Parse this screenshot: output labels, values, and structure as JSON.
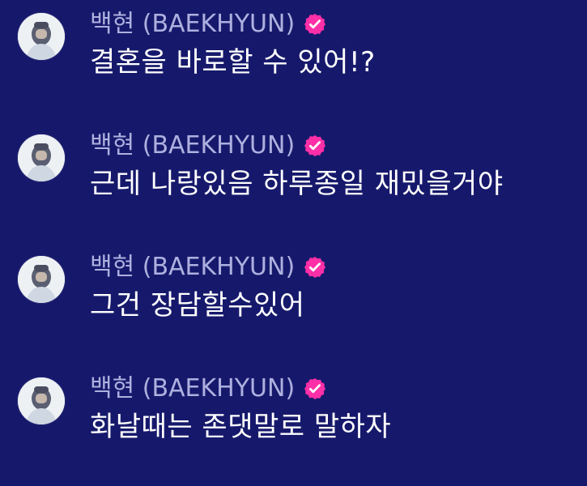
{
  "messages": [
    {
      "sender_name": "백현 (BAEKHYUN)",
      "text": "결혼을 바로할 수 있어!?"
    },
    {
      "sender_name": "백현 (BAEKHYUN)",
      "text": "근데 나랑있음 하루종일 재밌을거야"
    },
    {
      "sender_name": "백현 (BAEKHYUN)",
      "text": "그건 장담할수있어"
    },
    {
      "sender_name": "백현 (BAEKHYUN)",
      "text": "화날때는 존댓말로 말하자"
    }
  ],
  "icons": {
    "avatar": "avatar",
    "verified_badge": "verified-badge-icon"
  },
  "colors": {
    "background": "#16196b",
    "sender_name": "#aeb0df",
    "message_text": "#ffffff",
    "verified_badge": "#ff2fa8"
  }
}
